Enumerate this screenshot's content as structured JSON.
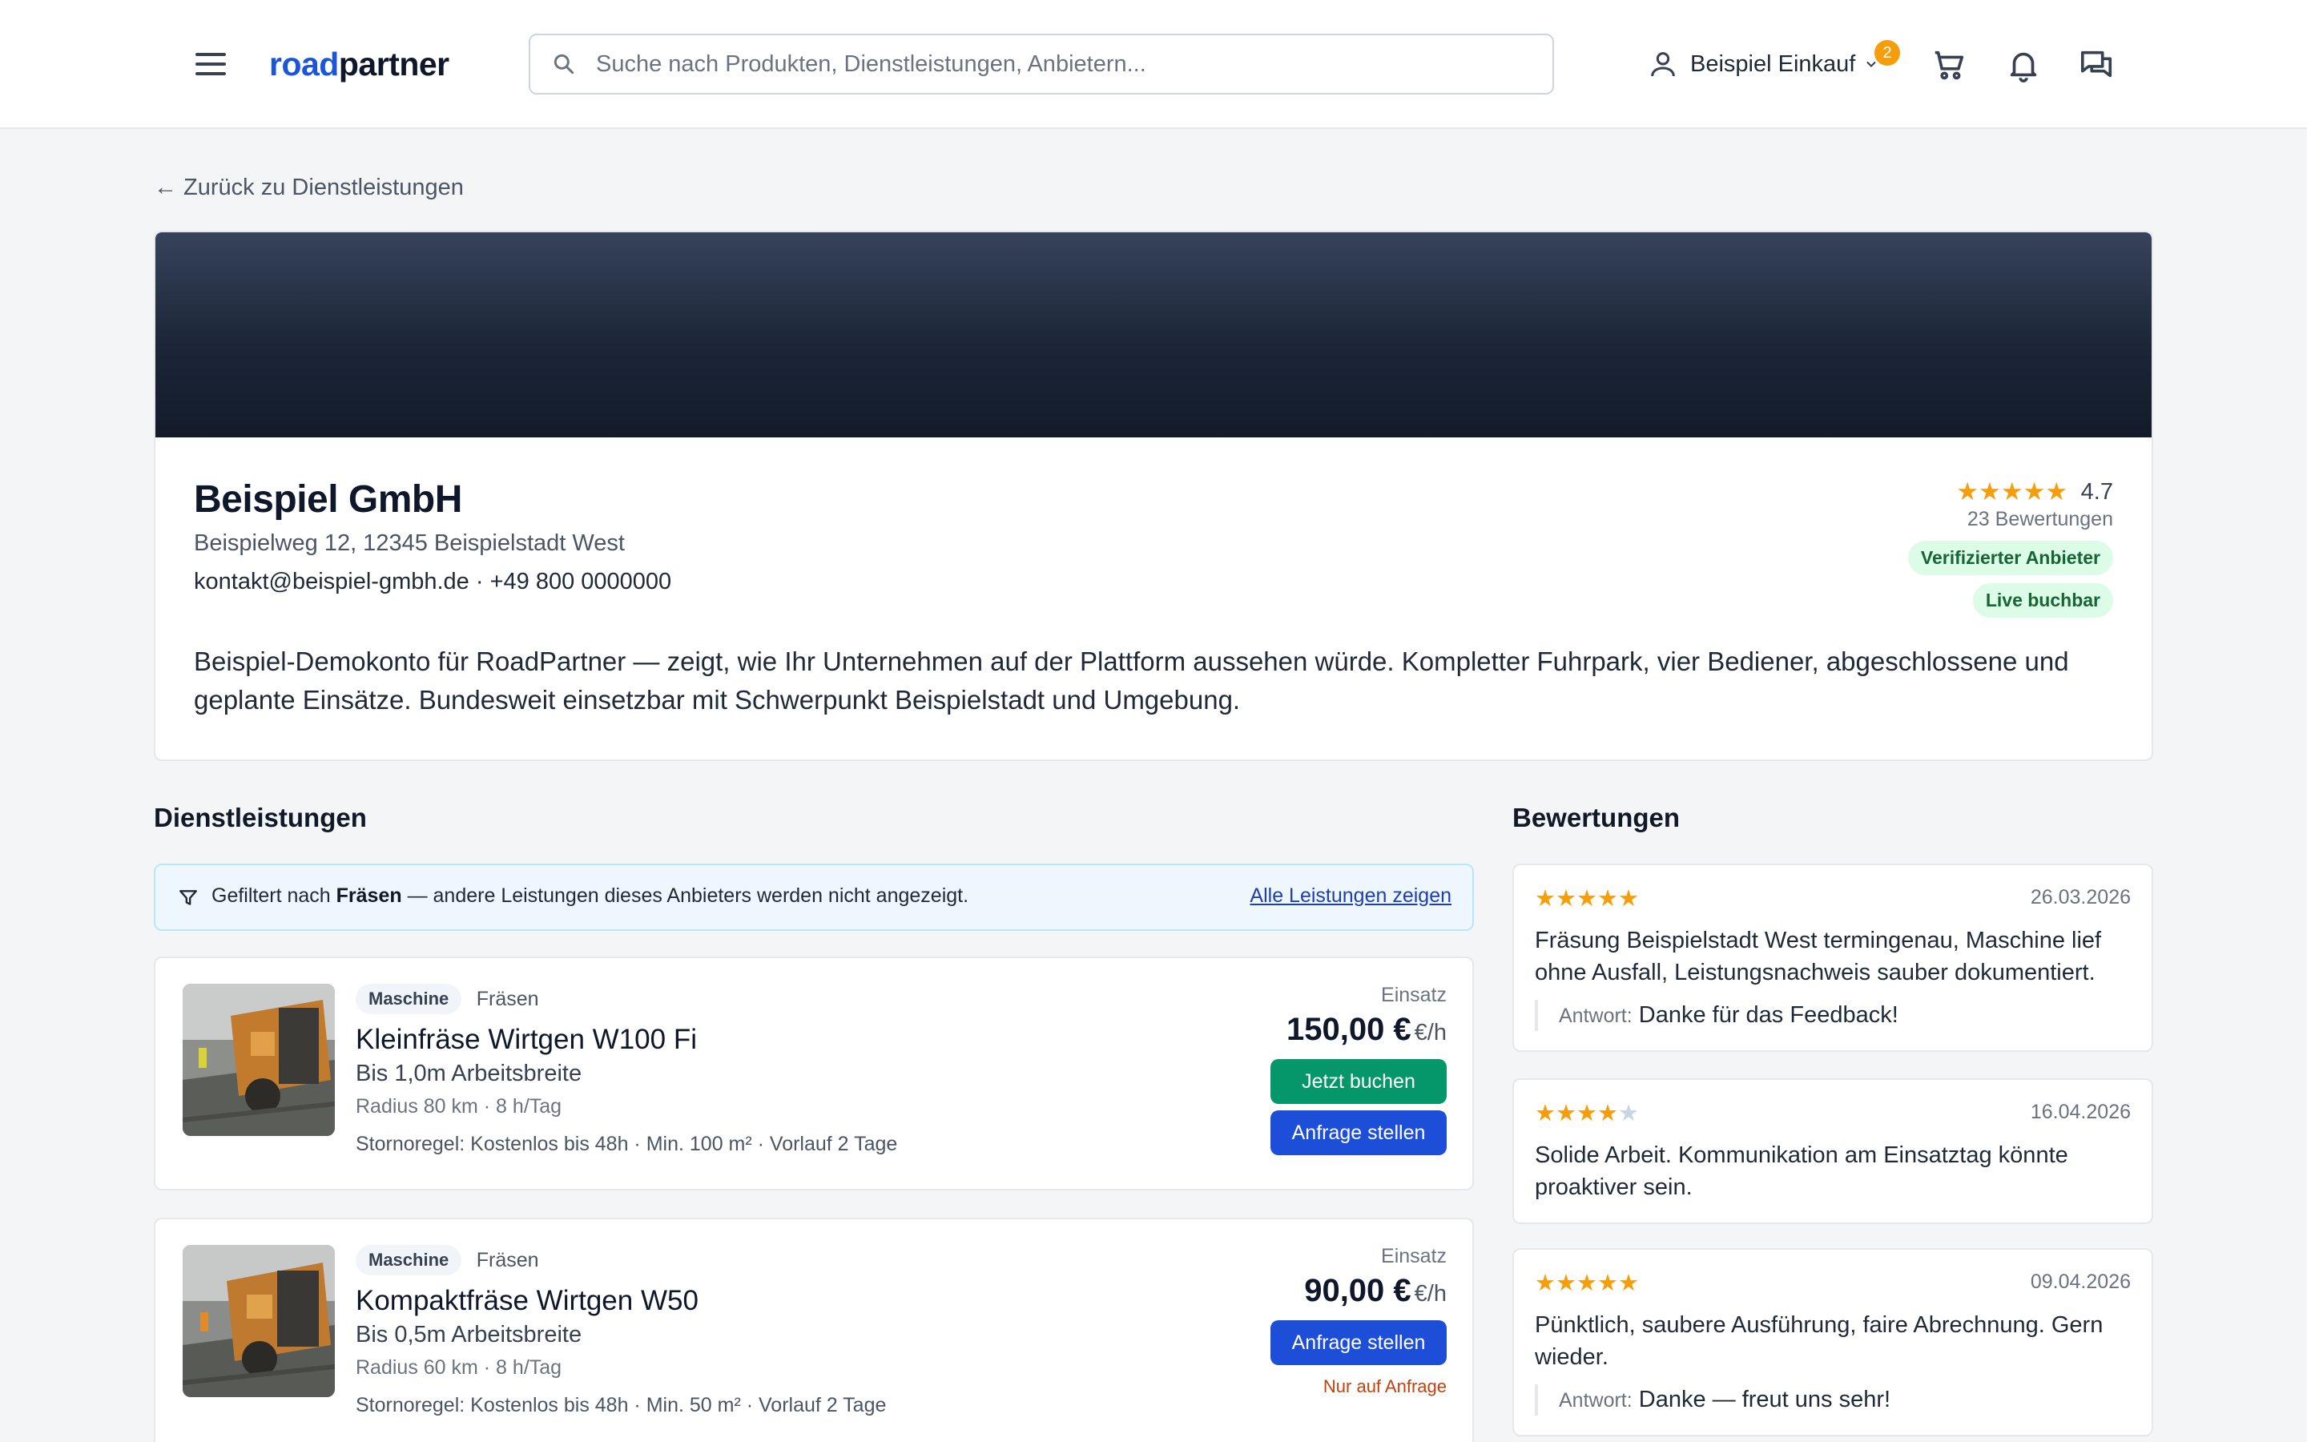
{
  "header": {
    "logo_part1": "road",
    "logo_part2": "partner",
    "search_placeholder": "Suche nach Produkten, Dienstleistungen, Anbietern...",
    "user_name": "Beispiel Einkauf",
    "notification_count": "2"
  },
  "back_link": "← Zurück zu Dienstleistungen",
  "provider": {
    "name": "Beispiel GmbH",
    "address": "Beispielweg 12, 12345 Beispielstadt West",
    "contact": "kontakt@beispiel-gmbh.de · +49 800 0000000",
    "description": "Beispiel-Demokonto für RoadPartner — zeigt, wie Ihr Unternehmen auf der Plattform aussehen würde. Kompletter Fuhrpark, vier Bediener, abgeschlossene und geplante Einsätze. Bundesweit einsetzbar mit Schwerpunkt Beispielstadt und Umgebung.",
    "rating": "4.7",
    "rating_stars": 5,
    "reviews_count": "23 Bewertungen",
    "badge_verified": "Verifizierter Anbieter",
    "badge_live": "Live buchbar"
  },
  "services_section": {
    "title": "Dienstleistungen",
    "filter_prefix": "Gefiltert nach",
    "filter_value": "Fräsen",
    "filter_suffix": "— andere Leistungen dieses Anbieters werden nicht angezeigt.",
    "filter_link": "Alle Leistungen zeigen"
  },
  "services": [
    {
      "tag": "Maschine",
      "category": "Fräsen",
      "name": "Kleinfräse Wirtgen W100 Fi",
      "subtitle": "Bis 1,0m Arbeitsbreite",
      "meta": "Radius 80 km · 8 h/Tag",
      "storno": "Stornoregel: Kostenlos bis 48h · Min. 100 m² · Vorlauf 2 Tage",
      "price_label": "Einsatz",
      "price": "150,00 €",
      "price_unit": "€/h",
      "book_button": "Jetzt buchen",
      "request_button": "Anfrage stellen"
    },
    {
      "tag": "Maschine",
      "category": "Fräsen",
      "name": "Kompaktfräse Wirtgen W50",
      "subtitle": "Bis 0,5m Arbeitsbreite",
      "meta": "Radius 60 km · 8 h/Tag",
      "storno": "Stornoregel: Kostenlos bis 48h · Min. 50 m² · Vorlauf 2 Tage",
      "price_label": "Einsatz",
      "price": "90,00 €",
      "price_unit": "€/h",
      "request_button": "Anfrage stellen",
      "on_request_note": "Nur auf Anfrage"
    }
  ],
  "reviews_section": {
    "title": "Bewertungen"
  },
  "reviews": [
    {
      "stars": 5,
      "date": "26.03.2026",
      "text": "Fräsung Beispielstadt West termingenau, Maschine lief ohne Ausfall, Leistungsnachweis sauber dokumentiert.",
      "reply_label": "Antwort:",
      "reply": "Danke für das Feedback!"
    },
    {
      "stars": 4,
      "date": "16.04.2026",
      "text": "Solide Arbeit. Kommunikation am Einsatztag könnte proaktiver sein."
    },
    {
      "stars": 5,
      "date": "09.04.2026",
      "text": "Pünktlich, saubere Ausführung, faire Abrechnung. Gern wieder.",
      "reply_label": "Antwort:",
      "reply": "Danke — freut uns sehr!"
    }
  ],
  "colors": {
    "brand_blue": "#1a56db",
    "star": "#f59e0b",
    "book_green": "#059669",
    "request_blue": "#1d4ed8",
    "on_request_orange": "#c2410c"
  },
  "icons": {
    "menu": "hamburger-icon",
    "search": "search-icon",
    "user": "user-icon",
    "cart": "cart-icon",
    "bell": "bell-icon",
    "chat": "chat-icon",
    "filter": "filter-icon"
  }
}
